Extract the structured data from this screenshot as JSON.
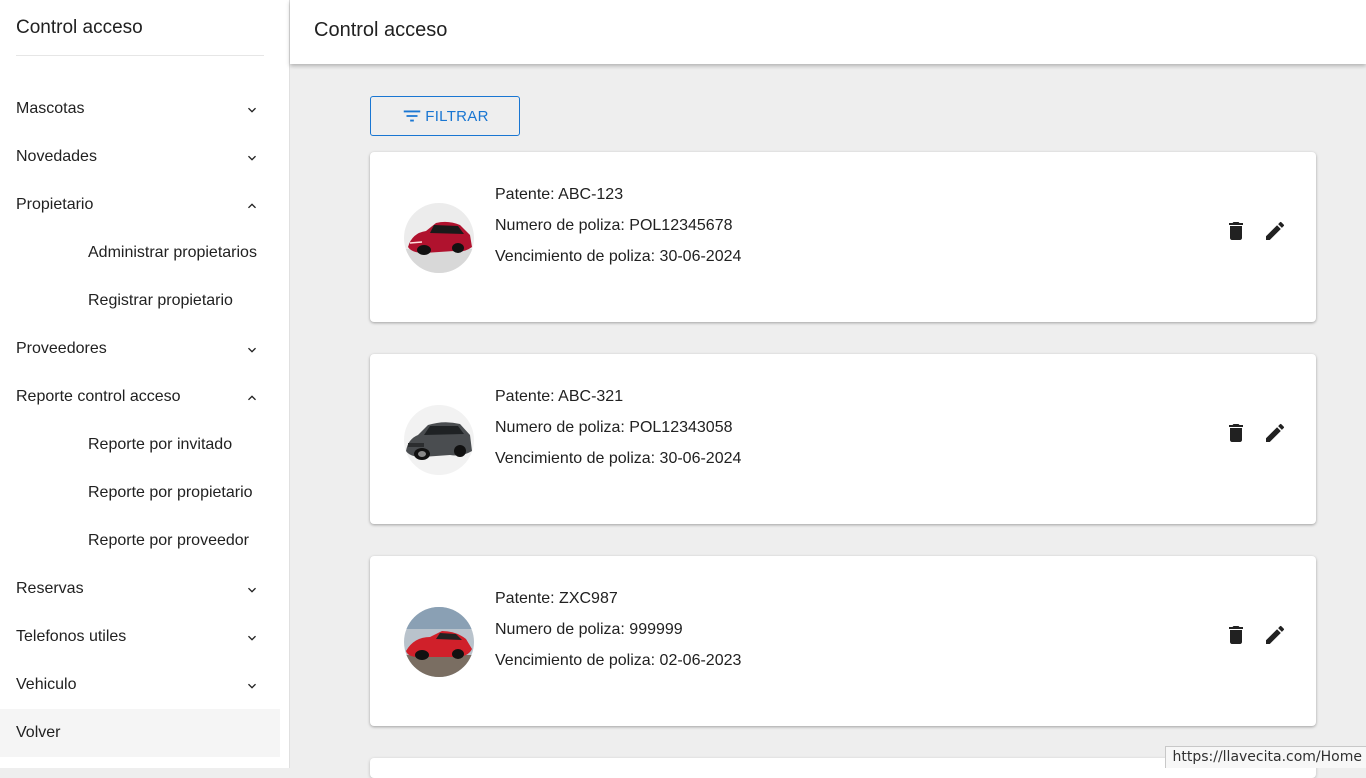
{
  "sidebar": {
    "title": "Control acceso",
    "items": [
      {
        "label": "Mascotas",
        "chevron": "down"
      },
      {
        "label": "Novedades",
        "chevron": "down"
      },
      {
        "label": "Propietario",
        "chevron": "up"
      },
      {
        "label": "Administrar propietarios",
        "sub": true
      },
      {
        "label": "Registrar propietario",
        "sub": true
      },
      {
        "label": "Proveedores",
        "chevron": "down"
      },
      {
        "label": "Reporte control acceso",
        "chevron": "up"
      },
      {
        "label": "Reporte por invitado",
        "sub": true
      },
      {
        "label": "Reporte por propietario",
        "sub": true
      },
      {
        "label": "Reporte por proveedor",
        "sub": true
      },
      {
        "label": "Reservas",
        "chevron": "down"
      },
      {
        "label": "Telefonos utiles",
        "chevron": "down"
      },
      {
        "label": "Vehiculo",
        "chevron": "down"
      },
      {
        "label": "Volver",
        "active": true
      }
    ]
  },
  "header": {
    "title": "Control acceso"
  },
  "filter": {
    "label": "FILTRAR",
    "icon": "filter-list-icon"
  },
  "vehicles": [
    {
      "patente": "Patente: ABC-123",
      "poliza": "Numero de poliza: POL12345678",
      "vencimiento": "Vencimiento de poliza: 30-06-2024",
      "car_color": "#b0122e"
    },
    {
      "patente": "Patente: ABC-321",
      "poliza": "Numero de poliza: POL12343058",
      "vencimiento": "Vencimiento de poliza: 30-06-2024",
      "car_color": "#4a4d50"
    },
    {
      "patente": "Patente: ZXC987",
      "poliza": "Numero de poliza: 999999",
      "vencimiento": "Vencimiento de poliza: 02-06-2023",
      "car_color": "#d0202a"
    }
  ],
  "status_url": "https://llavecita.com/Home",
  "colors": {
    "accent": "#1976d2",
    "icon": "#212121",
    "background": "#eeeeee"
  }
}
